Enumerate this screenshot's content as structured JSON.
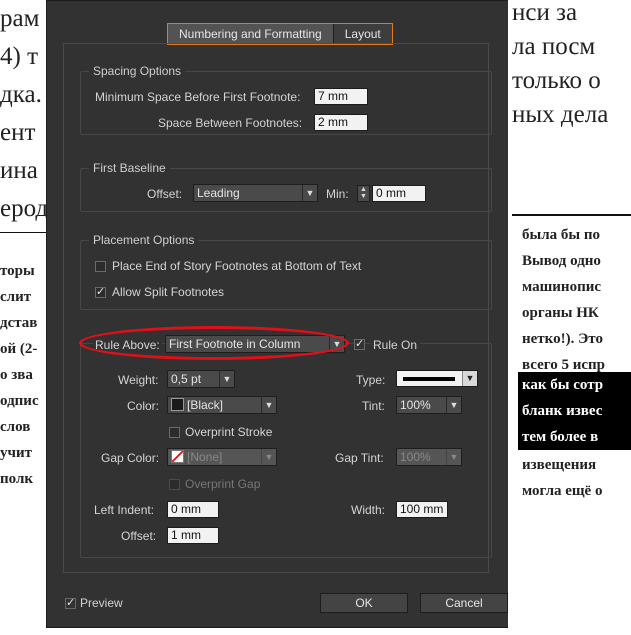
{
  "background_doc": {
    "left_lines": [
      "рам",
      "4) т",
      "дка.",
      "ент",
      "ина",
      "ерод"
    ],
    "right_top_lines": [
      "нси  за",
      "ла посм",
      "только о",
      "ных дела"
    ],
    "left_small_lines": [
      "торы",
      "слит",
      "дстав",
      "ой (2-",
      "о зва",
      "одпис",
      "слов",
      "учит",
      "полк"
    ],
    "right_small_lines": [
      "была бы по",
      "Вывод одно",
      "машинопис",
      "органы НК",
      "нетко!). Это",
      "всего 5 испр",
      "как бы сотр",
      "бланк извес",
      "тем более в",
      "извещения",
      "могла ещё о"
    ]
  },
  "dialog": {
    "tabs": [
      "Numbering and Formatting",
      "Layout"
    ],
    "spacing": {
      "title": "Spacing Options",
      "min_space_label": "Minimum Space Before First Footnote:",
      "min_space_value": "7 mm",
      "between_label": "Space Between Footnotes:",
      "between_value": "2 mm"
    },
    "baseline": {
      "title": "First Baseline",
      "offset_label": "Offset:",
      "offset_value": "Leading",
      "min_label": "Min:",
      "min_value": "0 mm"
    },
    "placement": {
      "title": "Placement Options",
      "end_of_story_label": "Place End of Story Footnotes at Bottom of Text",
      "end_of_story_checked": false,
      "split_label": "Allow Split Footnotes",
      "split_checked": true
    },
    "rule": {
      "rule_above_label": "Rule Above:",
      "rule_above_value": "First Footnote in Column",
      "rule_on_label": "Rule On",
      "rule_on_checked": true,
      "weight_label": "Weight:",
      "weight_value": "0,5 pt",
      "type_label": "Type:",
      "color_label": "Color:",
      "color_value": "[Black]",
      "color_swatch": "#1a1a1a",
      "tint_label": "Tint:",
      "tint_value": "100%",
      "overprint_stroke_label": "Overprint Stroke",
      "gap_color_label": "Gap Color:",
      "gap_color_value": "[None]",
      "gap_tint_label": "Gap Tint:",
      "gap_tint_value": "100%",
      "overprint_gap_label": "Overprint Gap",
      "left_indent_label": "Left Indent:",
      "left_indent_value": "0 mm",
      "width_label": "Width:",
      "width_value": "100 mm",
      "offset_label": "Offset:",
      "offset_value": "1 mm"
    },
    "preview_label": "Preview",
    "preview_checked": true,
    "ok_label": "OK",
    "cancel_label": "Cancel",
    "highlight_color": "#e0101a",
    "tab_accent": "#e07b1a"
  }
}
